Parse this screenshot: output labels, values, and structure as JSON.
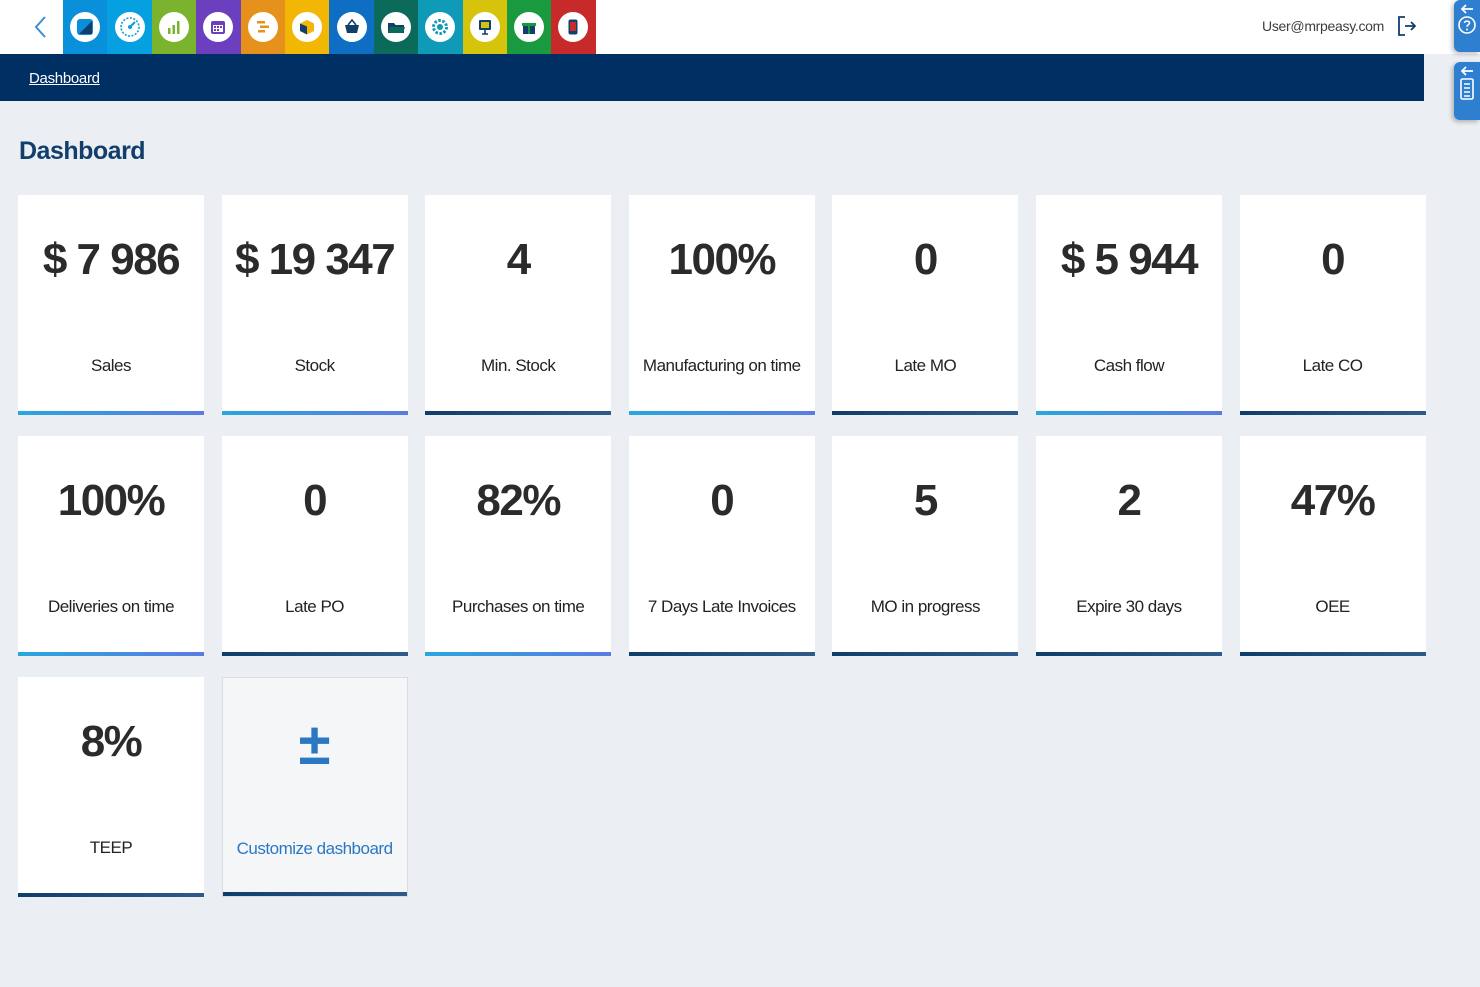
{
  "topbar": {
    "user_email": "User@mrpeasy.com",
    "modules": [
      {
        "name": "module-crm-icon",
        "color": "#0a8fdb"
      },
      {
        "name": "module-speedometer-icon",
        "color": "#06a0e0"
      },
      {
        "name": "module-reports-icon",
        "color": "#7bb32e"
      },
      {
        "name": "module-calendar-icon",
        "color": "#6c3fbf"
      },
      {
        "name": "module-production-planning-icon",
        "color": "#e6911c"
      },
      {
        "name": "module-stock-icon",
        "color": "#f2b705"
      },
      {
        "name": "module-procurement-icon",
        "color": "#0d6ec4"
      },
      {
        "name": "module-files-icon",
        "color": "#0b6a59"
      },
      {
        "name": "module-settings-icon",
        "color": "#0f9ab8"
      },
      {
        "name": "module-presentation-icon",
        "color": "#d5c40b"
      },
      {
        "name": "module-gift-icon",
        "color": "#1a9a3e"
      },
      {
        "name": "module-mobile-icon",
        "color": "#c62a2a"
      }
    ]
  },
  "navbar": {
    "breadcrumb": "Dashboard"
  },
  "page": {
    "title": "Dashboard"
  },
  "tiles": [
    {
      "value": "$ 7 986",
      "label": "Sales",
      "accent": "blue"
    },
    {
      "value": "$ 19 347",
      "label": "Stock",
      "accent": "blue"
    },
    {
      "value": "4",
      "label": "Min. Stock",
      "accent": "dark"
    },
    {
      "value": "100%",
      "label": "Manufacturing on time",
      "accent": "blue"
    },
    {
      "value": "0",
      "label": "Late MO",
      "accent": "dark"
    },
    {
      "value": "$ 5 944",
      "label": "Cash flow",
      "accent": "blue"
    },
    {
      "value": "0",
      "label": "Late CO",
      "accent": "dark"
    },
    {
      "value": "100%",
      "label": "Deliveries on time",
      "accent": "blue"
    },
    {
      "value": "0",
      "label": "Late PO",
      "accent": "dark"
    },
    {
      "value": "82%",
      "label": "Purchases on time",
      "accent": "blue"
    },
    {
      "value": "0",
      "label": "7 Days Late Invoices",
      "accent": "dark"
    },
    {
      "value": "5",
      "label": "MO in progress",
      "accent": "dark"
    },
    {
      "value": "2",
      "label": "Expire 30 days",
      "accent": "dark"
    },
    {
      "value": "47%",
      "label": "OEE",
      "accent": "dark"
    },
    {
      "value": "8%",
      "label": "TEEP",
      "accent": "dark"
    }
  ],
  "customize": {
    "symbol": "±",
    "label": "Customize dashboard"
  }
}
